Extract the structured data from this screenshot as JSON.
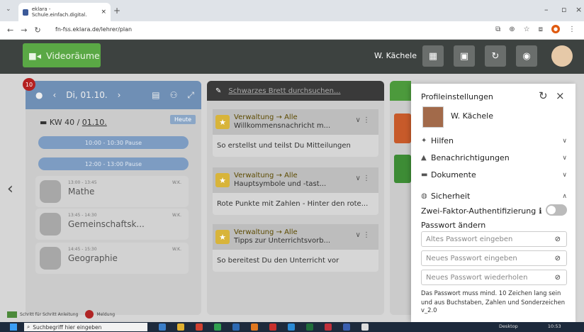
{
  "browser": {
    "tab_title": "eklara - Schule.einfach.digital.",
    "tab_close": "×",
    "new_tab": "+",
    "url": "fn-fss.eklara.de/lehrer/plan"
  },
  "header": {
    "video_label": "Videoräume",
    "user_name": "W. Kächele"
  },
  "day": {
    "badge": "10",
    "date": "Di, 01.10.",
    "kw_prefix": "KW 40 /",
    "kw_date": "01.10.",
    "today_button": "Heute",
    "pauses": [
      "10:00 - 10:30  Pause",
      "12:00 - 13:00  Pause"
    ],
    "lessons": [
      {
        "time": "13:00 - 13:45",
        "subject": "Mathe",
        "teacher": "W.K."
      },
      {
        "time": "13:45 - 14:30",
        "subject": "Gemeinschaftsk...",
        "teacher": "W.K."
      },
      {
        "time": "14:45 - 15:30",
        "subject": "Geographie",
        "teacher": "W.K."
      }
    ],
    "footer_text": "Schritt für Schritt Anleitung",
    "footer_report": "Meldung"
  },
  "board": {
    "search_placeholder": "Schwarzes Brett durchsuchen...",
    "cards": [
      {
        "category": "Verwaltung → Alle",
        "title": "Willkommensnachricht m...",
        "body": "So erstellst und teilst Du Mitteilungen"
      },
      {
        "category": "Verwaltung → Alle",
        "title": "Hauptsymbole und -tast...",
        "body": "Rote Punkte mit Zahlen - Hinter den rote..."
      },
      {
        "category": "Verwaltung → Alle",
        "title": "Tipps zur Unterrichtsvorb...",
        "body": "So bereitest Du den Unterricht vor"
      }
    ]
  },
  "panel": {
    "title": "Profileinstellungen",
    "name": "W. Kächele",
    "sections": [
      "Hilfen",
      "Benachrichtigungen",
      "Dokumente",
      "Sicherheit"
    ],
    "two_factor": "Zwei-Faktor-Authentifizierung",
    "pw_heading": "Passwort ändern",
    "pw_old": "Altes Passwort eingeben",
    "pw_new": "Neues Passwort eingeben",
    "pw_repeat": "Neues Passwort wiederholen",
    "hint": "Das Passwort muss mind. 10 Zeichen lang sein und aus Buchstaben, Zahlen und Sonderzeichen",
    "version": "v_2.0"
  },
  "taskbar": {
    "search_placeholder": "Suchbegriff hier eingeben",
    "desktop": "Desktop",
    "time": "10:53"
  },
  "colors": {
    "accent_green": "#5aa845",
    "header_dark": "#3d4240",
    "day_header": "#6f8fb5",
    "star": "#d8b43a"
  }
}
